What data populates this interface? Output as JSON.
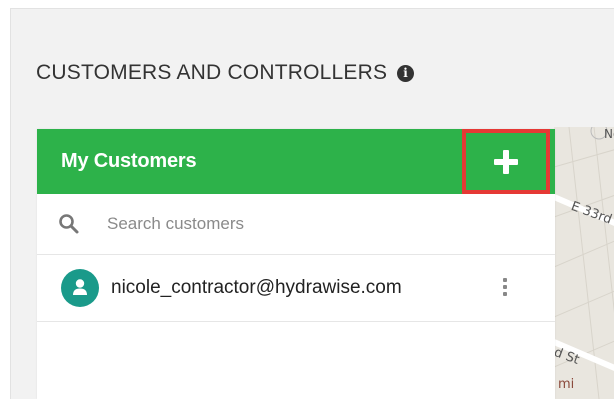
{
  "section": {
    "title": "CUSTOMERS AND CONTROLLERS",
    "info_icon": "info-icon"
  },
  "panel": {
    "title": "My Customers",
    "add_icon": "plus-icon",
    "search": {
      "placeholder": "Search customers",
      "value": "",
      "icon": "search-icon"
    },
    "customers": [
      {
        "email": "nicole_contractor@hydrawise.com",
        "avatar_icon": "user-icon",
        "menu_icon": "kebab-icon"
      }
    ]
  },
  "map": {
    "labels": [
      "No",
      "E 33rd",
      "d St",
      "mi"
    ]
  },
  "colors": {
    "header_green": "#2db24a",
    "highlight_red": "#e53935",
    "avatar_teal": "#1a9a8a"
  }
}
